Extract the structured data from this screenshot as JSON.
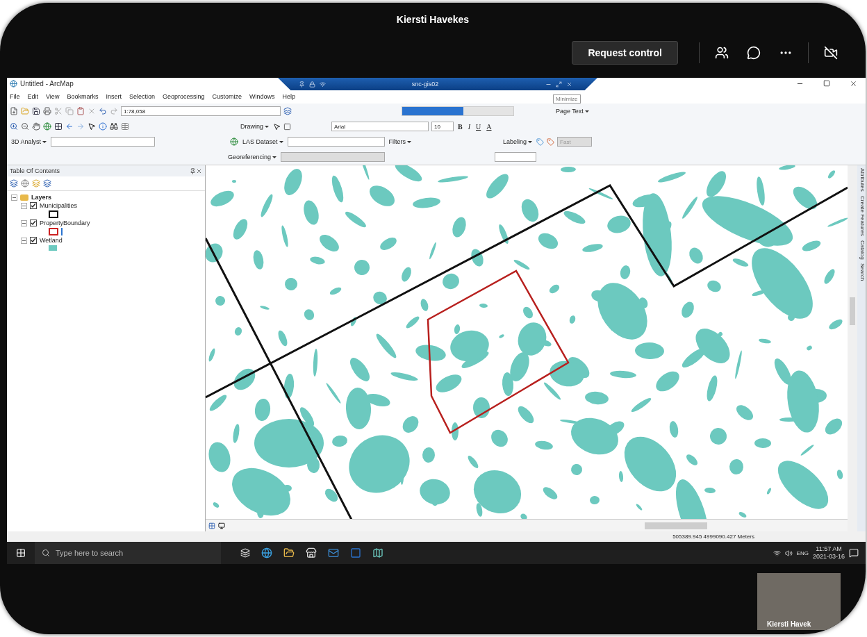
{
  "meeting": {
    "presenter": "Kiersti Havekes",
    "request_control": "Request control",
    "participant_tile": {
      "name": "Kiersti Havek"
    }
  },
  "app": {
    "title": "Untitled - ArcMap",
    "remote_bar": {
      "host": "snc-gis02",
      "tooltip": "Minimize"
    },
    "menu": [
      "File",
      "Edit",
      "View",
      "Bookmarks",
      "Insert",
      "Selection",
      "Geoprocessing",
      "Customize",
      "Windows",
      "Help"
    ],
    "toolbars": {
      "scale": "1:78,058",
      "page_text": "Page Text",
      "drawing": "Drawing",
      "font": "Arial",
      "font_size": "10",
      "bold": "B",
      "italic": "I",
      "underline": "U",
      "font_color": "A",
      "analyst": "3D Analyst",
      "las": "LAS Dataset",
      "filters": "Filters",
      "labeling": "Labeling",
      "label_quality": "Fast",
      "georeferencing": "Georeferencing",
      "slider": {
        "level": 0.55
      }
    },
    "toc": {
      "title": "Table Of Contents",
      "root": {
        "label": "Layers",
        "expanded": true,
        "children": [
          {
            "label": "Municipalities",
            "checked": true,
            "expanded": true,
            "kind": "outline",
            "color": "#111111"
          },
          {
            "label": "PropertyBoundary",
            "checked": true,
            "expanded": true,
            "kind": "outline",
            "color": "#cc2222"
          },
          {
            "label": "Wetland",
            "checked": true,
            "expanded": true,
            "kind": "fill",
            "color": "#6cc9bf"
          }
        ]
      }
    },
    "side_tabs": [
      "Attributes",
      "Create Features",
      "Catalog",
      "Search"
    ],
    "status": "505389.945 4999090.427 Meters"
  },
  "taskbar": {
    "search_placeholder": "Type here to search",
    "language": "ENG",
    "time": "11:57 AM",
    "date": "2021-03-16"
  }
}
